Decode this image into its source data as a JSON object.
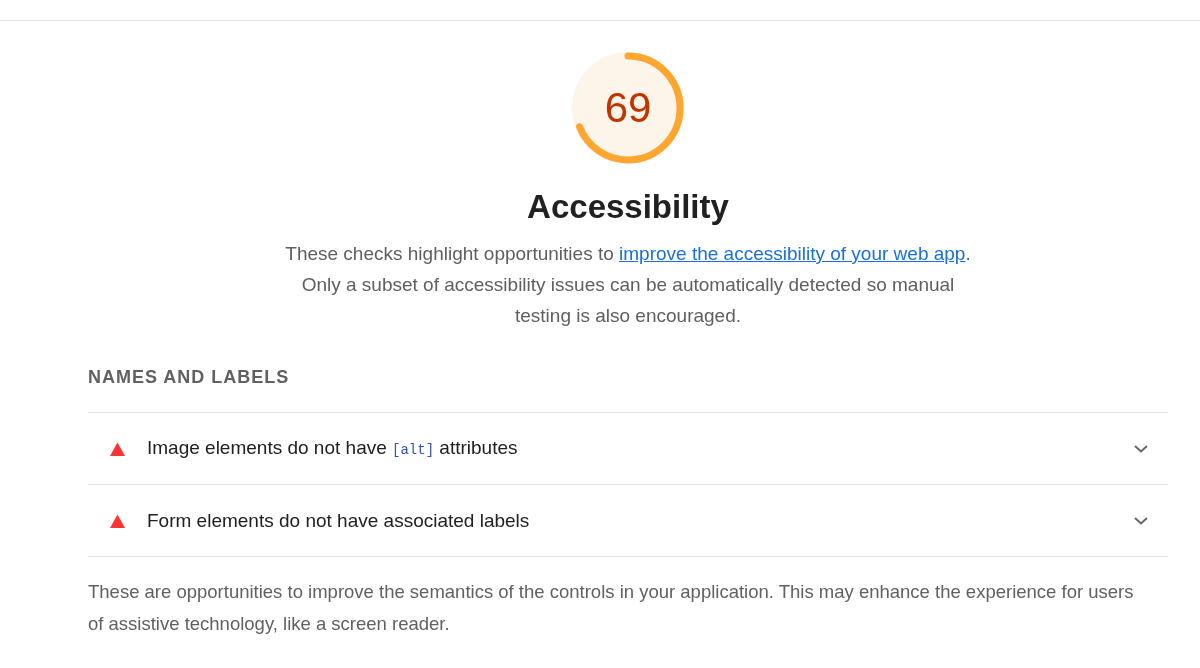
{
  "header": {
    "gauge": {
      "score": "69",
      "level": 0.69
    },
    "title": "Accessibility",
    "description": {
      "before": "These checks highlight opportunities to ",
      "link": "improve the accessibility of your web app",
      "after": ". Only a subset of accessibility issues can be automatically detected so manual testing is also encouraged."
    }
  },
  "group": {
    "title": "NAMES AND LABELS",
    "audits": [
      {
        "failed": true,
        "expanded": false,
        "title_parts": [
          {
            "kind": "text",
            "text": "Image elements do not have "
          },
          {
            "kind": "code",
            "text": "[alt]"
          },
          {
            "kind": "text",
            "text": " attributes"
          }
        ]
      },
      {
        "failed": true,
        "expanded": false,
        "title_parts": [
          {
            "kind": "text",
            "text": "Form elements do not have associated labels"
          }
        ]
      }
    ],
    "description": "These are opportunities to improve the semantics of the controls in your application. This may enhance the experience for users of assistive technology, like a screen reader."
  }
}
